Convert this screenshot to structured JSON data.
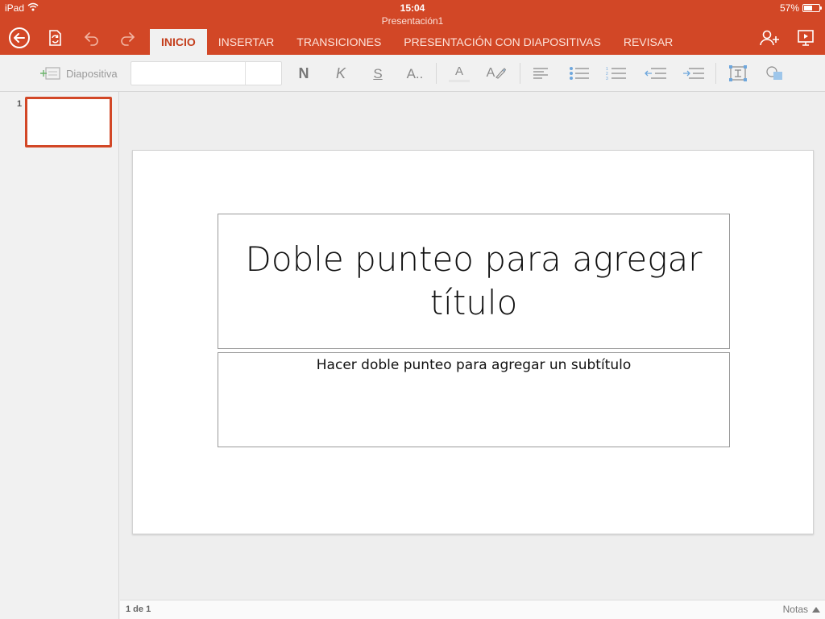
{
  "status_bar": {
    "device": "iPad",
    "time": "15:04",
    "battery_text": "57%",
    "battery_level": 0.57
  },
  "document": {
    "title": "Presentación1"
  },
  "toolbar_icons": {
    "back": "back-arrow-circle-icon",
    "file": "file-sync-icon",
    "undo": "undo-icon",
    "redo": "redo-icon",
    "share": "add-person-icon",
    "present": "present-screen-icon"
  },
  "tabs": [
    {
      "label": "INICIO",
      "active": true
    },
    {
      "label": "INSERTAR",
      "active": false
    },
    {
      "label": "TRANSICIONES",
      "active": false
    },
    {
      "label": "PRESENTACIÓN CON DIAPOSITIVAS",
      "active": false
    },
    {
      "label": "REVISAR",
      "active": false
    }
  ],
  "ribbon": {
    "new_slide_label": "Diapositiva",
    "font_name": "",
    "font_size": "",
    "bold_label": "N",
    "italic_label": "K",
    "underline_label": "S",
    "font_more_label": "A..",
    "font_color_label": "A",
    "highlight_label": "A"
  },
  "thumbnails": [
    {
      "number": "1",
      "selected": true
    }
  ],
  "slide": {
    "title_placeholder": "Doble punteo para agregar título",
    "subtitle_placeholder": "Hacer doble punteo para agregar un subtítulo"
  },
  "footer": {
    "slide_counter": "1 de 1",
    "notes_label": "Notas"
  },
  "colors": {
    "accent": "#d24726",
    "ribbon_bg": "#f1f1f1",
    "icon_gray": "#8a8a8a"
  }
}
